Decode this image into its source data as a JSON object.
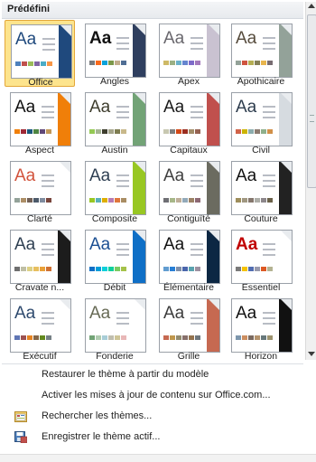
{
  "header": {
    "title": "Prédéfini"
  },
  "themes": [
    {
      "label": "Office",
      "aa_color": "#1f497d",
      "aa_bold": false,
      "accent": "#1f497d",
      "fold": true,
      "swatches": [
        "#4f81bd",
        "#c0504d",
        "#9bbb59",
        "#8064a2",
        "#4bacc6",
        "#f79646"
      ],
      "selected": true
    },
    {
      "label": "Angles",
      "aa_color": "#111111",
      "aa_bold": true,
      "accent": "#2f3f5f",
      "fold": true,
      "swatches": [
        "#797b7e",
        "#f96a1b",
        "#08a1d9",
        "#7c984a",
        "#c2ad8d",
        "#506e94"
      ],
      "selected": false
    },
    {
      "label": "Apex",
      "aa_color": "#69676d",
      "aa_bold": false,
      "accent": "#c9c2d1",
      "fold": true,
      "swatches": [
        "#ceb966",
        "#9cb084",
        "#6bb1c9",
        "#6585cf",
        "#7e6bc9",
        "#a379bb"
      ],
      "selected": false
    },
    {
      "label": "Apothicaire",
      "aa_color": "#564b3c",
      "aa_bold": false,
      "accent": "#93a299",
      "fold": true,
      "swatches": [
        "#93a299",
        "#cf543f",
        "#b5ae53",
        "#848058",
        "#e8b54d",
        "#786c71"
      ],
      "selected": false
    },
    {
      "label": "Aspect",
      "aa_color": "#111111",
      "aa_bold": false,
      "accent": "#f07f09",
      "fold": true,
      "swatches": [
        "#f07f09",
        "#9f2936",
        "#1b587c",
        "#4e8542",
        "#604878",
        "#c19859"
      ],
      "selected": false
    },
    {
      "label": "Austin",
      "aa_color": "#3e3d2d",
      "aa_bold": false,
      "accent": "#72a376",
      "fold": true,
      "swatches": [
        "#94c954",
        "#a5b592",
        "#3e3d2d",
        "#a5a58a",
        "#7e7d51",
        "#c8b88a"
      ],
      "selected": false
    },
    {
      "label": "Capitaux",
      "aa_color": "#1a1a1a",
      "aa_bold": false,
      "accent": "#c0504d",
      "fold": true,
      "swatches": [
        "#c8c8b1",
        "#7f7f7f",
        "#d34817",
        "#9b2d1f",
        "#a28e6a",
        "#956251"
      ],
      "selected": false
    },
    {
      "label": "Civil",
      "aa_color": "#2e3d4e",
      "aa_bold": false,
      "accent": "#d6dbe0",
      "fold": true,
      "swatches": [
        "#d16349",
        "#ccb400",
        "#8cadae",
        "#8c7b70",
        "#8fb08c",
        "#d19049"
      ],
      "selected": false
    },
    {
      "label": "Clarté",
      "aa_color": "#d2533c",
      "aa_bold": false,
      "accent": "#ffffff",
      "fold": true,
      "swatches": [
        "#93a299",
        "#ad8f67",
        "#726056",
        "#4c5a6a",
        "#808da0",
        "#79463d"
      ],
      "selected": false
    },
    {
      "label": "Composite",
      "aa_color": "#2e3f52",
      "aa_bold": false,
      "accent": "#98c723",
      "fold": true,
      "swatches": [
        "#98c723",
        "#59b0b9",
        "#deae00",
        "#b77bb4",
        "#e0773c",
        "#a98d63"
      ],
      "selected": false
    },
    {
      "label": "Contiguïté",
      "aa_color": "#3f3f3f",
      "aa_bold": false,
      "accent": "#6b6b60",
      "fold": true,
      "swatches": [
        "#6f6f74",
        "#a7b789",
        "#beae98",
        "#92a9b9",
        "#9c8265",
        "#8d6974"
      ],
      "selected": false
    },
    {
      "label": "Couture",
      "aa_color": "#111111",
      "aa_bold": false,
      "accent": "#222222",
      "fold": true,
      "swatches": [
        "#9e8e5c",
        "#a09781",
        "#85776d",
        "#aeafa9",
        "#8d878b",
        "#6b6149"
      ],
      "selected": false
    },
    {
      "label": "Cravate n...",
      "aa_color": "#2e3f52",
      "aa_bold": false,
      "accent": "#1c1c1c",
      "fold": true,
      "swatches": [
        "#6f6f6f",
        "#bfbfa5",
        "#dcd084",
        "#e7bf5f",
        "#e9a039",
        "#cf7133"
      ],
      "selected": false
    },
    {
      "label": "Débit",
      "aa_color": "#1b4f93",
      "aa_bold": false,
      "accent": "#0f6fc6",
      "fold": true,
      "swatches": [
        "#0f6fc6",
        "#009dd9",
        "#0bd0d9",
        "#10cf9b",
        "#7cca62",
        "#a5c249"
      ],
      "selected": false
    },
    {
      "label": "Élémentaire",
      "aa_color": "#111111",
      "aa_bold": false,
      "accent": "#0c2743",
      "fold": true,
      "swatches": [
        "#629dd1",
        "#297fd5",
        "#7f8fa9",
        "#4a66ac",
        "#5aa2ae",
        "#9d90a0"
      ],
      "selected": false
    },
    {
      "label": "Essentiel",
      "aa_color": "#c00000",
      "aa_bold": true,
      "accent": "#ffffff",
      "fold": true,
      "swatches": [
        "#7a7a7a",
        "#f5c201",
        "#526db0",
        "#989aac",
        "#dc5924",
        "#b4b392"
      ],
      "selected": false
    },
    {
      "label": "Exécutif",
      "aa_color": "#2e4a6e",
      "aa_bold": false,
      "accent": "#ffffff",
      "fold": true,
      "swatches": [
        "#6076b4",
        "#9c5252",
        "#e68422",
        "#846648",
        "#63891f",
        "#758085"
      ],
      "selected": false
    },
    {
      "label": "Fonderie",
      "aa_color": "#676a55",
      "aa_bold": false,
      "accent": "#ffffff",
      "fold": true,
      "swatches": [
        "#72a376",
        "#b0ccb0",
        "#a8cdd7",
        "#c0beaf",
        "#cec597",
        "#e8b7b7"
      ],
      "selected": false
    },
    {
      "label": "Grille",
      "aa_color": "#3c3c3c",
      "aa_bold": false,
      "accent": "#c66951",
      "fold": true,
      "swatches": [
        "#c66951",
        "#bf974d",
        "#928b70",
        "#87706b",
        "#94734e",
        "#6f777d"
      ],
      "selected": false
    },
    {
      "label": "Horizon",
      "aa_color": "#111111",
      "aa_bold": false,
      "accent": "#111111",
      "fold": true,
      "swatches": [
        "#7e97ad",
        "#cc8e60",
        "#7a6a60",
        "#b4936d",
        "#67787b",
        "#9d936f"
      ],
      "selected": false
    }
  ],
  "menu": [
    {
      "label": "Restaurer le thème à partir du modèle",
      "icon": null
    },
    {
      "label": "Activer les mises à jour de contenu sur Office.com...",
      "icon": null
    },
    {
      "label": "Rechercher les thèmes...",
      "icon": "browse-themes-icon"
    },
    {
      "label": "Enregistrer le thème actif...",
      "icon": "save-theme-icon"
    }
  ]
}
